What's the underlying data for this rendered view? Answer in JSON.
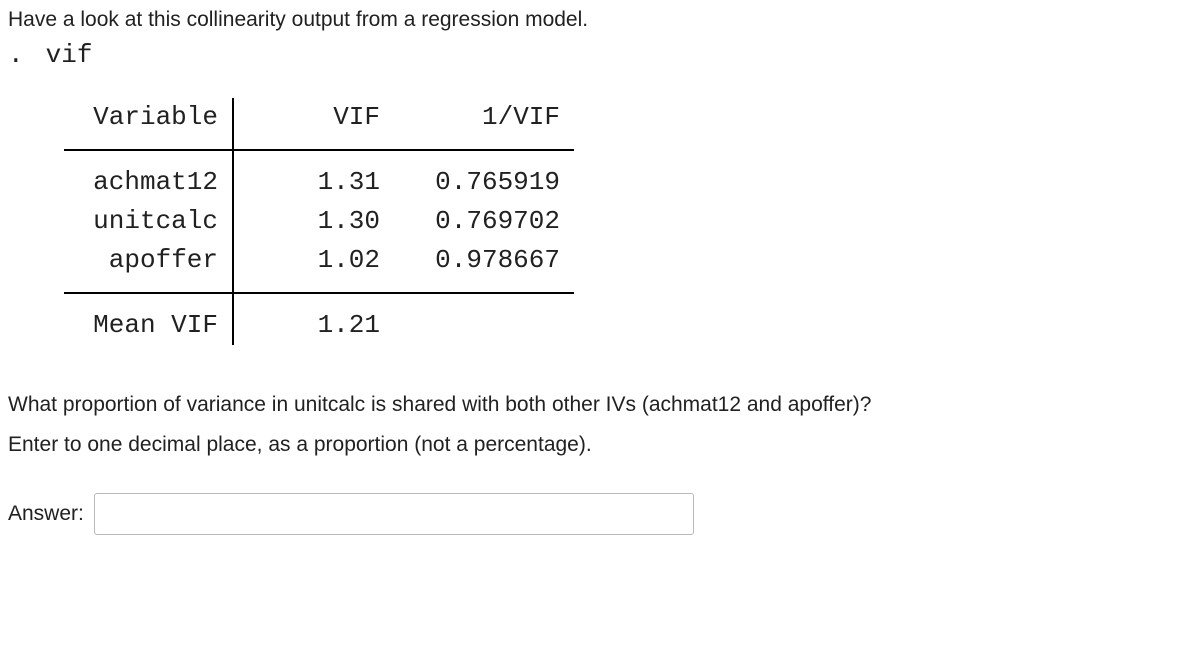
{
  "intro": "Have a look at this collinearity output from a regression model.",
  "cmd": {
    "prompt": ".",
    "text": "vif"
  },
  "table": {
    "headers": {
      "c1": "Variable",
      "c2": "VIF",
      "c3": "1/VIF"
    },
    "rows": [
      {
        "c1": "achmat12",
        "c2": "1.31",
        "c3": "0.765919"
      },
      {
        "c1": "unitcalc",
        "c2": "1.30",
        "c3": "0.769702"
      },
      {
        "c1": "apoffer",
        "c2": "1.02",
        "c3": "0.978667"
      }
    ],
    "footer": {
      "c1": "Mean VIF",
      "c2": "1.21"
    }
  },
  "question": {
    "line1": "What proportion of variance in unitcalc is shared with both other IVs (achmat12 and apoffer)?",
    "line2": "Enter to one decimal place, as a proportion (not a percentage)."
  },
  "answer": {
    "label": "Answer:",
    "value": ""
  }
}
